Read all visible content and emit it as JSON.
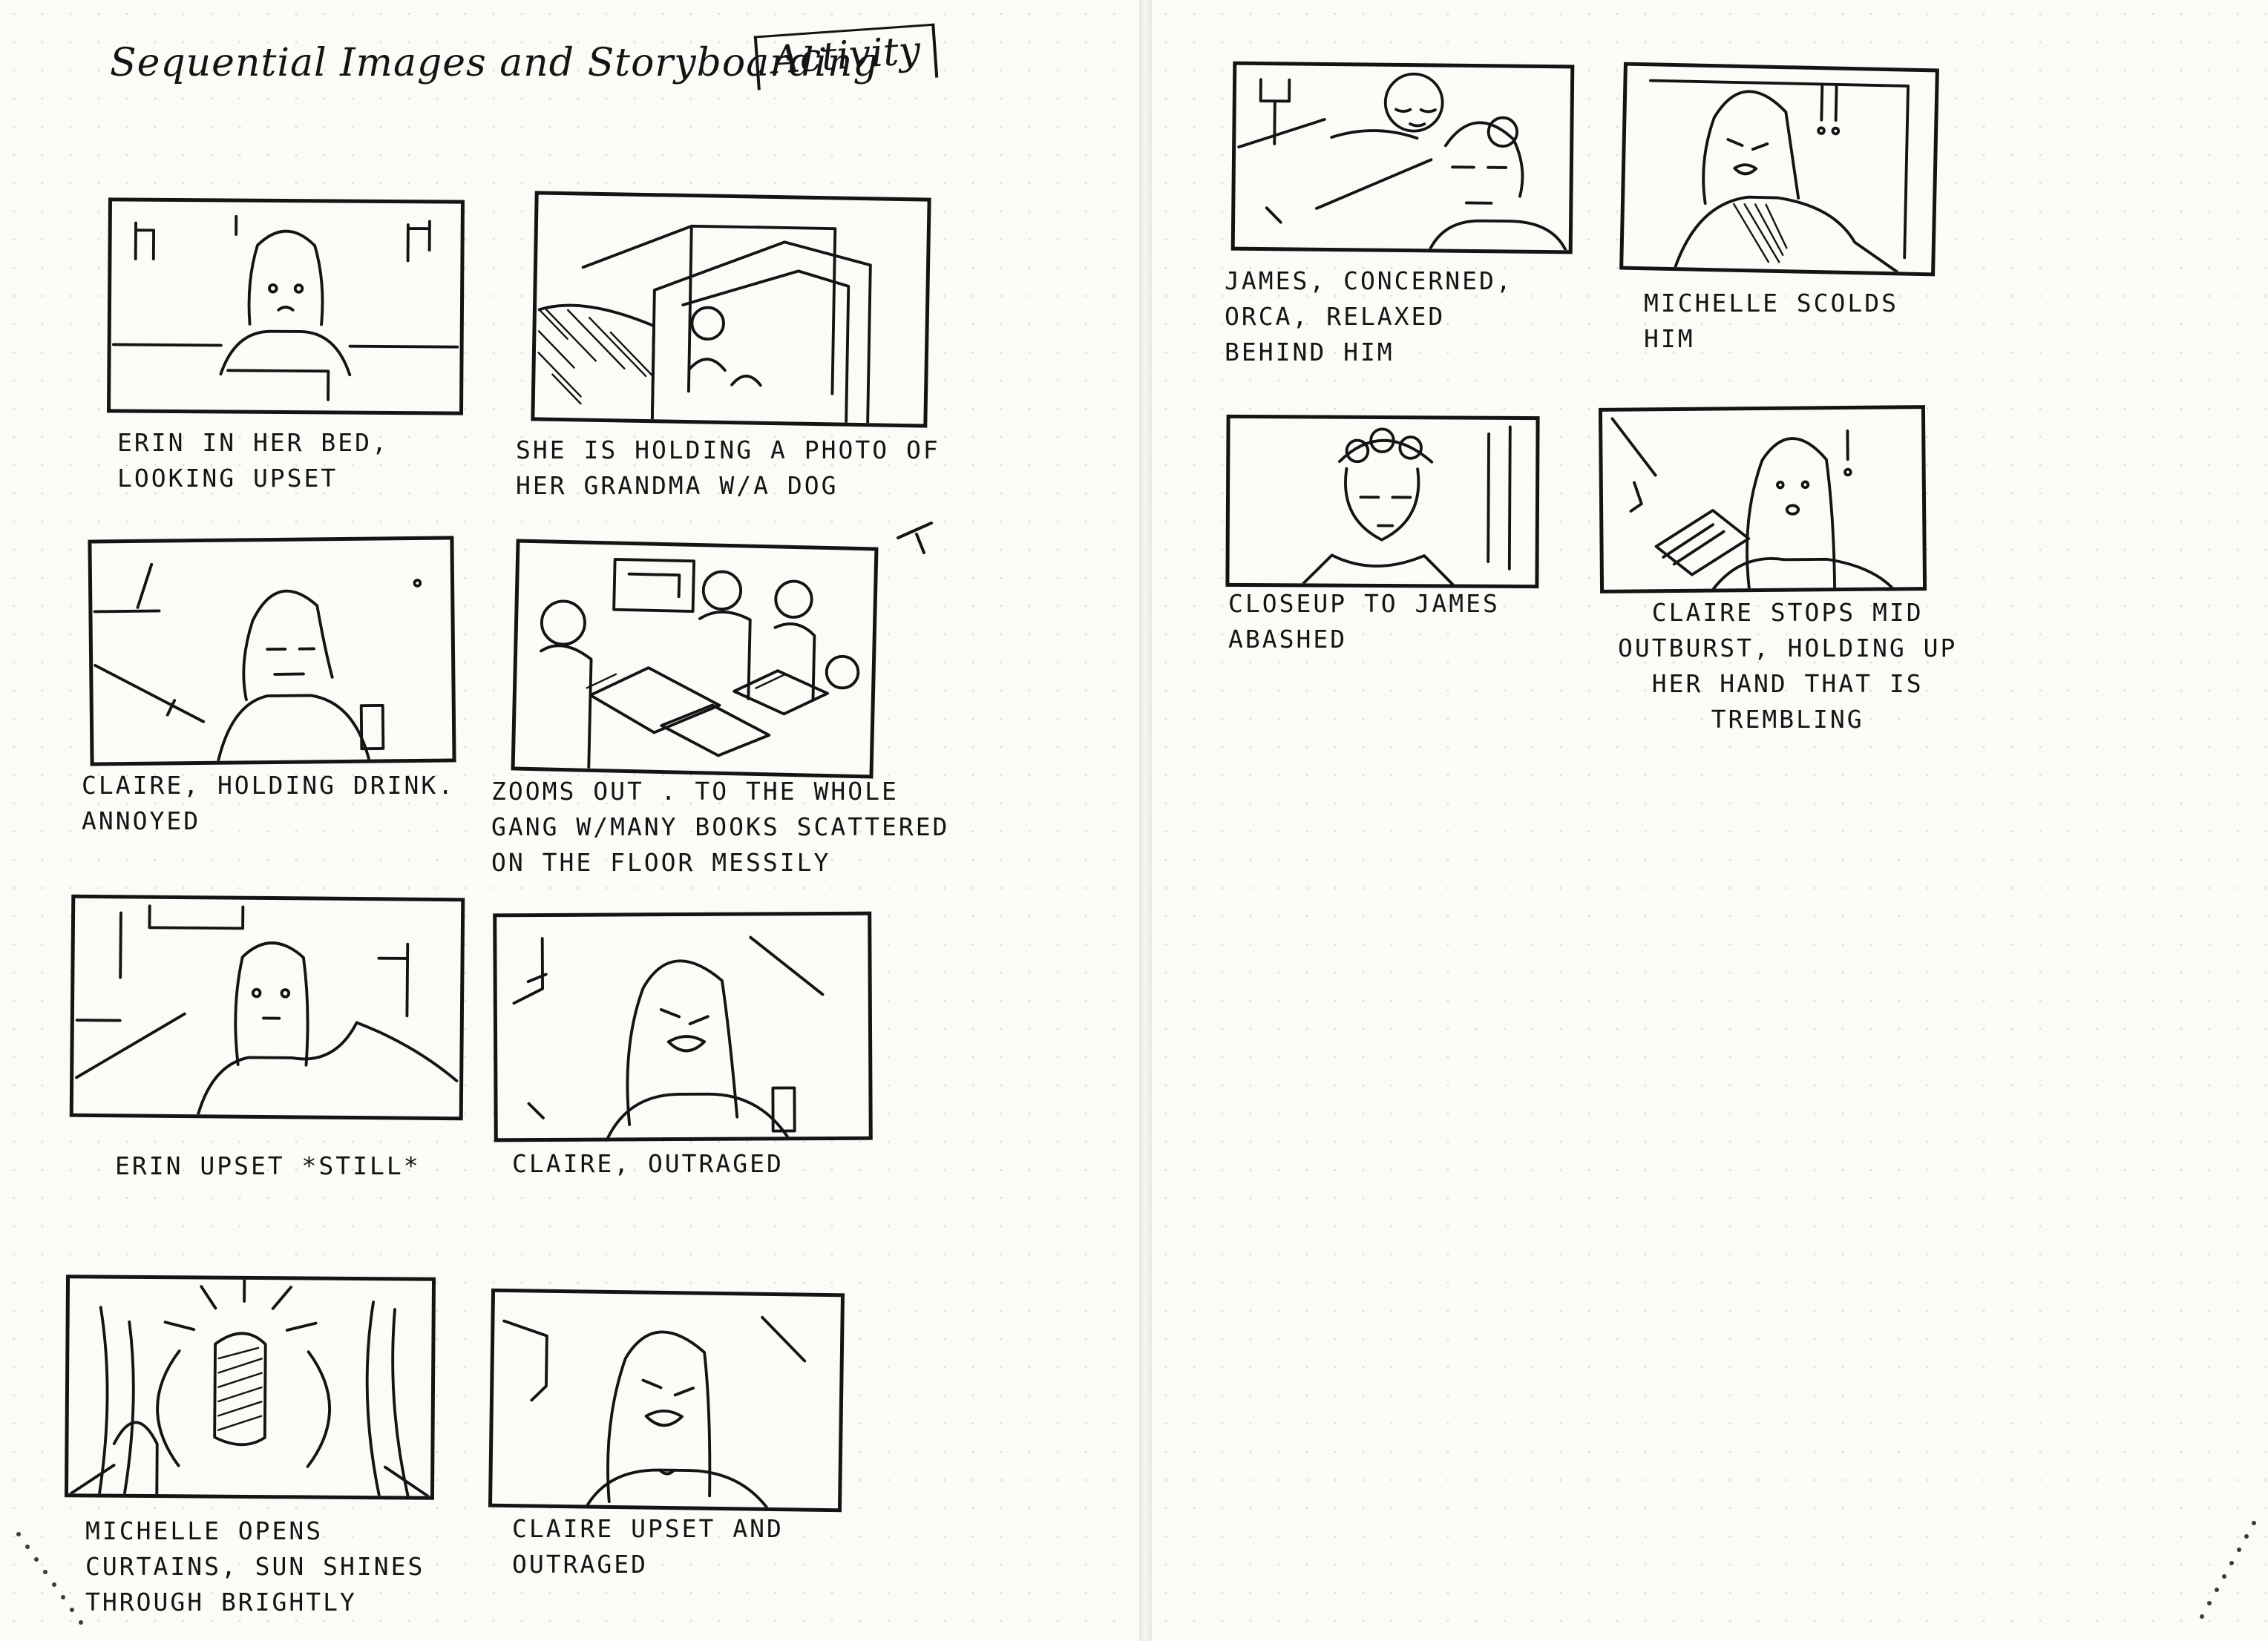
{
  "header": {
    "title": "Sequential Images and Storyboarding",
    "tag": "Activity"
  },
  "panels": [
    {
      "caption": "ERIN IN HER BED,\nLOOKING UPSET"
    },
    {
      "caption": "SHE IS HOLDING A PHOTO OF\nHER GRANDMA W/A DOG"
    },
    {
      "caption": "CLAIRE, HOLDING DRINK.\nANNOYED"
    },
    {
      "caption": "ZOOMS OUT . TO THE WHOLE\nGANG W/MANY BOOKS SCATTERED\nON THE FLOOR MESSILY"
    },
    {
      "caption": "ERIN UPSET *STILL*"
    },
    {
      "caption": "CLAIRE, OUTRAGED"
    },
    {
      "caption": "MICHELLE OPENS\nCURTAINS, SUN SHINES\nTHROUGH BRIGHTLY"
    },
    {
      "caption": "CLAIRE UPSET AND\nOUTRAGED"
    },
    {
      "caption": "JAMES, CONCERNED,\nORCA, RELAXED\nBEHIND HIM"
    },
    {
      "caption": "MICHELLE SCOLDS\nHIM"
    },
    {
      "caption": "CLOSEUP TO JAMES\nABASHED"
    },
    {
      "caption": "CLAIRE STOPS MID\nOUTBURST, HOLDING UP\nHER HAND THAT IS\nTREMBLING"
    }
  ]
}
